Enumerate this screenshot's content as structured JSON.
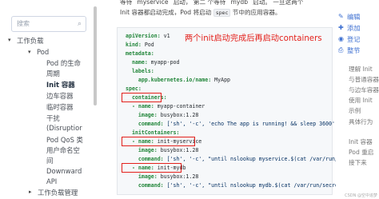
{
  "sidebar": {
    "search_placeholder": "搜索",
    "search_icon": "search-icon",
    "items": [
      {
        "label": "工作负载",
        "arrow": "▾"
      },
      {
        "label": "Pod",
        "arrow": "▾"
      },
      {
        "label": "Pod 的生命"
      },
      {
        "label": "周期"
      },
      {
        "label": "Init 容器"
      },
      {
        "label": "边车容器"
      },
      {
        "label": "临时容器"
      },
      {
        "label": "干扰"
      },
      {
        "label": "(Disruptior"
      },
      {
        "label": "Pod QoS 类"
      },
      {
        "label": "用户命名空"
      },
      {
        "label": "间"
      },
      {
        "label": "Downward"
      },
      {
        "label": "API"
      },
      {
        "label": "工作负载管理",
        "arrow": "▸"
      }
    ]
  },
  "main": {
    "intro_line1": "等待 `myservice` 启动，  第二 个等待 `mydb` 启动。  一旦这两个",
    "intro_line2_a": "Init 容器都启动完成，Pod 将启动",
    "intro_line2_code": "spec",
    "intro_line2_b": "节中的应用容器。",
    "annotation": "两个init启动完成后再启动containers",
    "code_lines": [
      {
        "k": "apiVersion:",
        "v": " v1"
      },
      {
        "k": "kind:",
        "v": " Pod"
      },
      {
        "k": "metadata:",
        "v": ""
      },
      {
        "k": "  name:",
        "v": " myapp-pod"
      },
      {
        "k": "  labels:",
        "v": ""
      },
      {
        "k": "    app.kubernetes.io/name:",
        "v": " MyApp"
      },
      {
        "k": "spec:",
        "v": ""
      },
      {
        "k": "  containers:",
        "v": ""
      },
      {
        "k": "  - name:",
        "v": " myapp-container"
      },
      {
        "k": "    image:",
        "v": " busybox:1.28"
      },
      {
        "k": "    command:",
        "v": " ['sh', '-c', 'echo The app is running! && sleep 3600']"
      },
      {
        "k": "  initContainers:",
        "v": ""
      },
      {
        "k": "  - name:",
        "v": " init-myservice"
      },
      {
        "k": "    image:",
        "v": " busybox:1.28"
      },
      {
        "k": "    command:",
        "v": " ['sh', '-c', \"until nslookup myservice.$(cat /var/run/secre"
      },
      {
        "k": "  - name:",
        "v": " init-mydb"
      },
      {
        "k": "    image:",
        "v": " busybox:1.28"
      },
      {
        "k": "    command:",
        "v": " ['sh', '-c', \"until nslookup mydb.$(cat /var/run/secrets/ku"
      }
    ]
  },
  "right": {
    "links": [
      {
        "icon": "edit-icon",
        "label": "编辑"
      },
      {
        "icon": "plus-icon",
        "label": "添加"
      },
      {
        "icon": "login-icon",
        "label": "登记"
      },
      {
        "icon": "print-icon",
        "label": "整节"
      }
    ],
    "toc": [
      "理解 Init",
      "与普通容器",
      "与边车容器",
      "使用 Init",
      "示例",
      "具体行为",
      "Init 容器",
      "Pod 重启",
      "接下来"
    ]
  },
  "footer": "CSDN @空中追梦"
}
